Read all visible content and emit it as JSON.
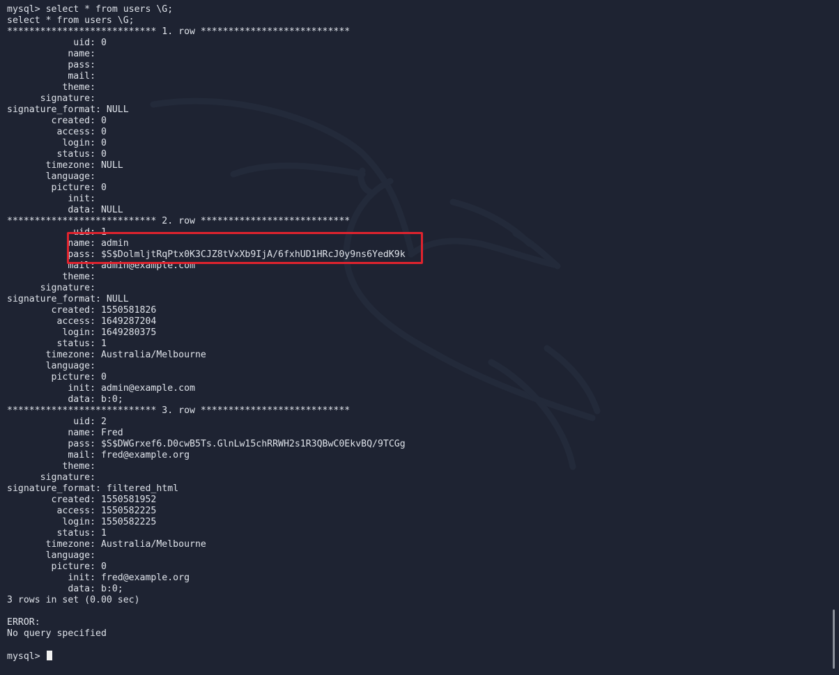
{
  "terminal": {
    "lines": [
      "mysql> select * from users \\G;",
      "select * from users \\G;",
      "*************************** 1. row ***************************",
      "            uid: 0",
      "           name: ",
      "           pass: ",
      "           mail: ",
      "          theme: ",
      "      signature: ",
      "signature_format: NULL",
      "        created: 0",
      "         access: 0",
      "          login: 0",
      "         status: 0",
      "       timezone: NULL",
      "       language: ",
      "        picture: 0",
      "           init: ",
      "           data: NULL",
      "*************************** 2. row ***************************",
      "            uid: 1",
      "           name: admin",
      "           pass: $S$DolmljtRqPtx0K3CJZ8tVxXb9IjA/6fxhUD1HRcJ0y9ns6YedK9k",
      "           mail: admin@example.com",
      "          theme: ",
      "      signature: ",
      "signature_format: NULL",
      "        created: 1550581826",
      "         access: 1649287204",
      "          login: 1649280375",
      "         status: 1",
      "       timezone: Australia/Melbourne",
      "       language: ",
      "        picture: 0",
      "           init: admin@example.com",
      "           data: b:0;",
      "*************************** 3. row ***************************",
      "            uid: 2",
      "           name: Fred",
      "           pass: $S$DWGrxef6.D0cwB5Ts.GlnLw15chRRWH2s1R3QBwC0EkvBQ/9TCGg",
      "           mail: fred@example.org",
      "          theme: ",
      "      signature: ",
      "signature_format: filtered_html",
      "        created: 1550581952",
      "         access: 1550582225",
      "          login: 1550582225",
      "         status: 1",
      "       timezone: Australia/Melbourne",
      "       language: ",
      "        picture: 0",
      "           init: fred@example.org",
      "           data: b:0;",
      "3 rows in set (0.00 sec)",
      "",
      "ERROR:",
      "No query specified",
      ""
    ],
    "prompt": "mysql> ",
    "colors": {
      "background": "#1e2332",
      "text": "#dfe3ea",
      "highlight_border": "#e0232e",
      "cursor": "#f2f2f2"
    }
  }
}
